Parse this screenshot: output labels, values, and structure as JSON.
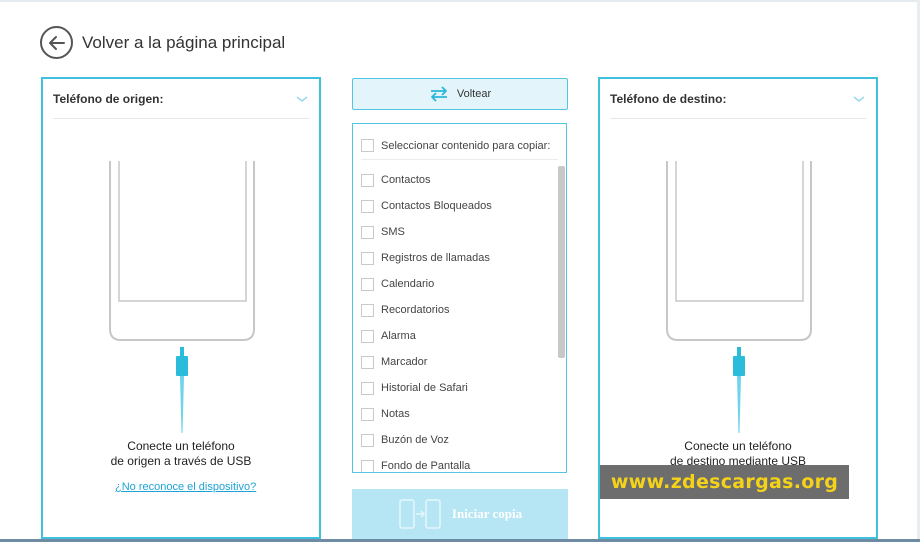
{
  "nav": {
    "back_label": "Volver a la página principal",
    "back_icon": "arrow-left-icon"
  },
  "source": {
    "title": "Teléfono de origen:",
    "status_line1": "Conecte un teléfono",
    "status_line2": "de origen a través de USB",
    "help_link": "¿No reconoce el dispositivo?"
  },
  "destination": {
    "title": "Teléfono de destino:",
    "status_line1": "Conecte un teléfono",
    "status_line2": "de destino mediante USB"
  },
  "flip_button": {
    "label": "Voltear",
    "icon": "swap-arrows-icon"
  },
  "content_list": {
    "select_all_label": "Seleccionar contenido para copiar:",
    "items": [
      "Contactos",
      "Contactos Bloqueados",
      "SMS",
      "Registros de llamadas",
      "Calendario",
      "Recordatorios",
      "Alarma",
      "Marcador",
      "Historial de Safari",
      "Notas",
      "Buzón de Voz",
      "Fondo de Pantalla"
    ]
  },
  "start_button": {
    "label": "Iniciar copia",
    "icon": "copy-phones-icon"
  },
  "watermark": {
    "text": "www.zdescargas.org"
  },
  "colors": {
    "accent": "#3fc0dd",
    "cable": "#2bbcdc",
    "link": "#1ea3d4",
    "start_disabled": "#b6e5f4",
    "watermark_text": "#f5d21a"
  }
}
